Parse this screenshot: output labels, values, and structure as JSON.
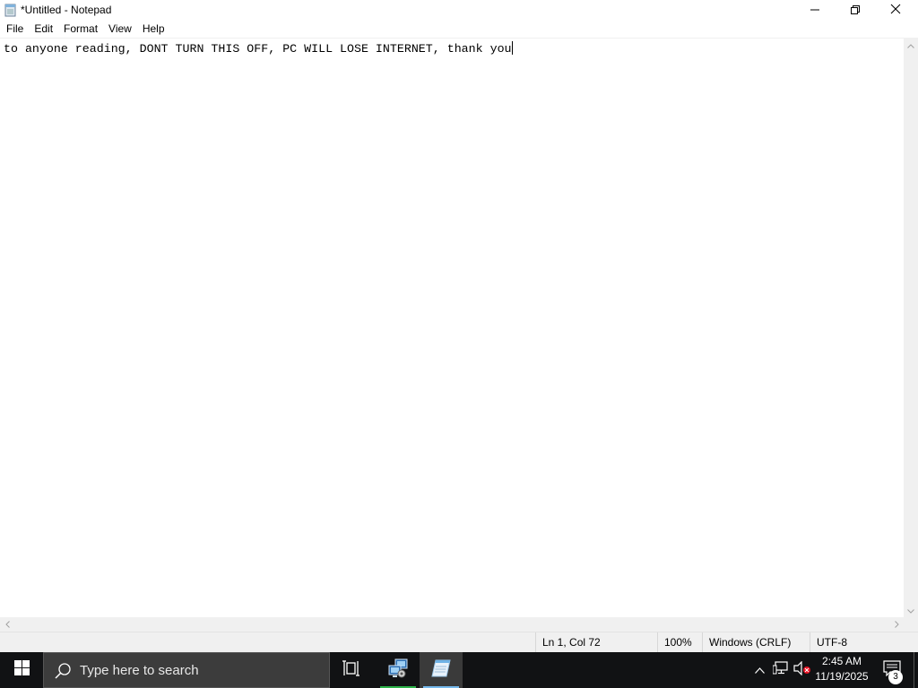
{
  "window": {
    "title": "*Untitled - Notepad",
    "icons": {
      "app": "notepad-icon",
      "minimize": "minimize-icon",
      "maximize": "restore-icon",
      "close": "close-icon"
    }
  },
  "menu": {
    "items": [
      {
        "label": "File"
      },
      {
        "label": "Edit"
      },
      {
        "label": "Format"
      },
      {
        "label": "View"
      },
      {
        "label": "Help"
      }
    ]
  },
  "editor": {
    "content": "to anyone reading, DONT TURN THIS OFF, PC WILL LOSE INTERNET, thank you"
  },
  "statusbar": {
    "position": "Ln 1, Col 72",
    "zoom": "100%",
    "line_ending": "Windows (CRLF)",
    "encoding": "UTF-8"
  },
  "taskbar": {
    "search_placeholder": "Type here to search",
    "time": "2:45 AM",
    "date": "11/19/2025",
    "notification_count": "3",
    "colors": {
      "background": "#111214",
      "search_bg": "#3c3c3c",
      "active_underline": "#76b9ed",
      "pinned_underline": "#2db34a"
    }
  }
}
